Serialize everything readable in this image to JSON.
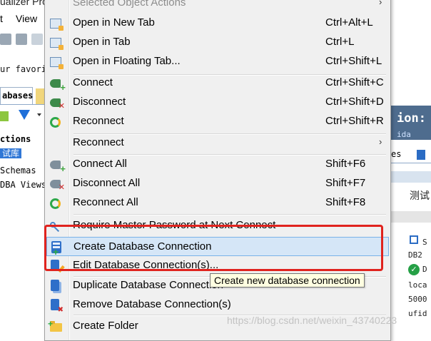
{
  "app": {
    "title_fragment": "ualizer Pro",
    "menubar": [
      "t",
      "View"
    ],
    "favorites_fragment": "ur favori",
    "tab_label": "abases",
    "tree": {
      "root": "ctions",
      "selected": "试库",
      "children": [
        "Schemas",
        "DBA Views"
      ]
    }
  },
  "right_panel": {
    "header": "ion: 测",
    "subtitle": "ida",
    "tab_label": "es",
    "body_cn": "测试",
    "info_lines": [
      "DB2",
      "loca",
      "5000",
      "ufid"
    ],
    "info_top": "S",
    "check_line": "D"
  },
  "context_menu": {
    "header": "Selected Object Actions",
    "items": [
      {
        "label": "Open in New Tab",
        "shortcut": "Ctrl+Alt+L",
        "icon": "open-tab-icon"
      },
      {
        "label": "Open in Tab",
        "shortcut": "Ctrl+L",
        "icon": "open-tab-icon"
      },
      {
        "label": "Open in Floating Tab...",
        "shortcut": "Ctrl+Shift+L",
        "icon": "open-tab-icon"
      },
      {
        "label": "Connect",
        "shortcut": "Ctrl+Shift+C",
        "icon": "connect-plug-icon"
      },
      {
        "label": "Disconnect",
        "shortcut": "Ctrl+Shift+D",
        "icon": "disconnect-plug-icon"
      },
      {
        "label": "Reconnect",
        "shortcut": "Ctrl+Shift+R",
        "icon": "reconnect-icon"
      },
      {
        "label": "Reconnect",
        "shortcut": "",
        "icon": "",
        "submenu": true
      },
      {
        "label": "Connect All",
        "shortcut": "Shift+F6",
        "icon": "connect-all-icon"
      },
      {
        "label": "Disconnect All",
        "shortcut": "Shift+F7",
        "icon": "disconnect-all-icon"
      },
      {
        "label": "Reconnect All",
        "shortcut": "Shift+F8",
        "icon": "reconnect-all-icon"
      },
      {
        "label": "Require Master Password at Next Connect",
        "shortcut": "",
        "icon": "key-icon"
      },
      {
        "label": "Create Database Connection",
        "shortcut": "",
        "icon": "create-db-icon"
      },
      {
        "label": "Edit Database Connection(s)...",
        "shortcut": "",
        "icon": "edit-db-icon"
      },
      {
        "label": "Duplicate Database Connection",
        "shortcut": "",
        "icon": "duplicate-db-icon"
      },
      {
        "label": "Remove Database Connection(s)",
        "shortcut": "",
        "icon": "remove-db-icon"
      },
      {
        "label": "Create Folder",
        "shortcut": "",
        "icon": "create-folder-icon"
      }
    ]
  },
  "tooltip": "Create new database connection",
  "watermark": "https://blog.csdn.net/weixin_43740223",
  "colors": {
    "menu_bg": "#f0f0f0",
    "highlight_bg": "#d5e6f7",
    "highlight_border": "#7ab2e8",
    "annotation": "#e0231e",
    "tooltip_bg": "#ffffe1"
  }
}
